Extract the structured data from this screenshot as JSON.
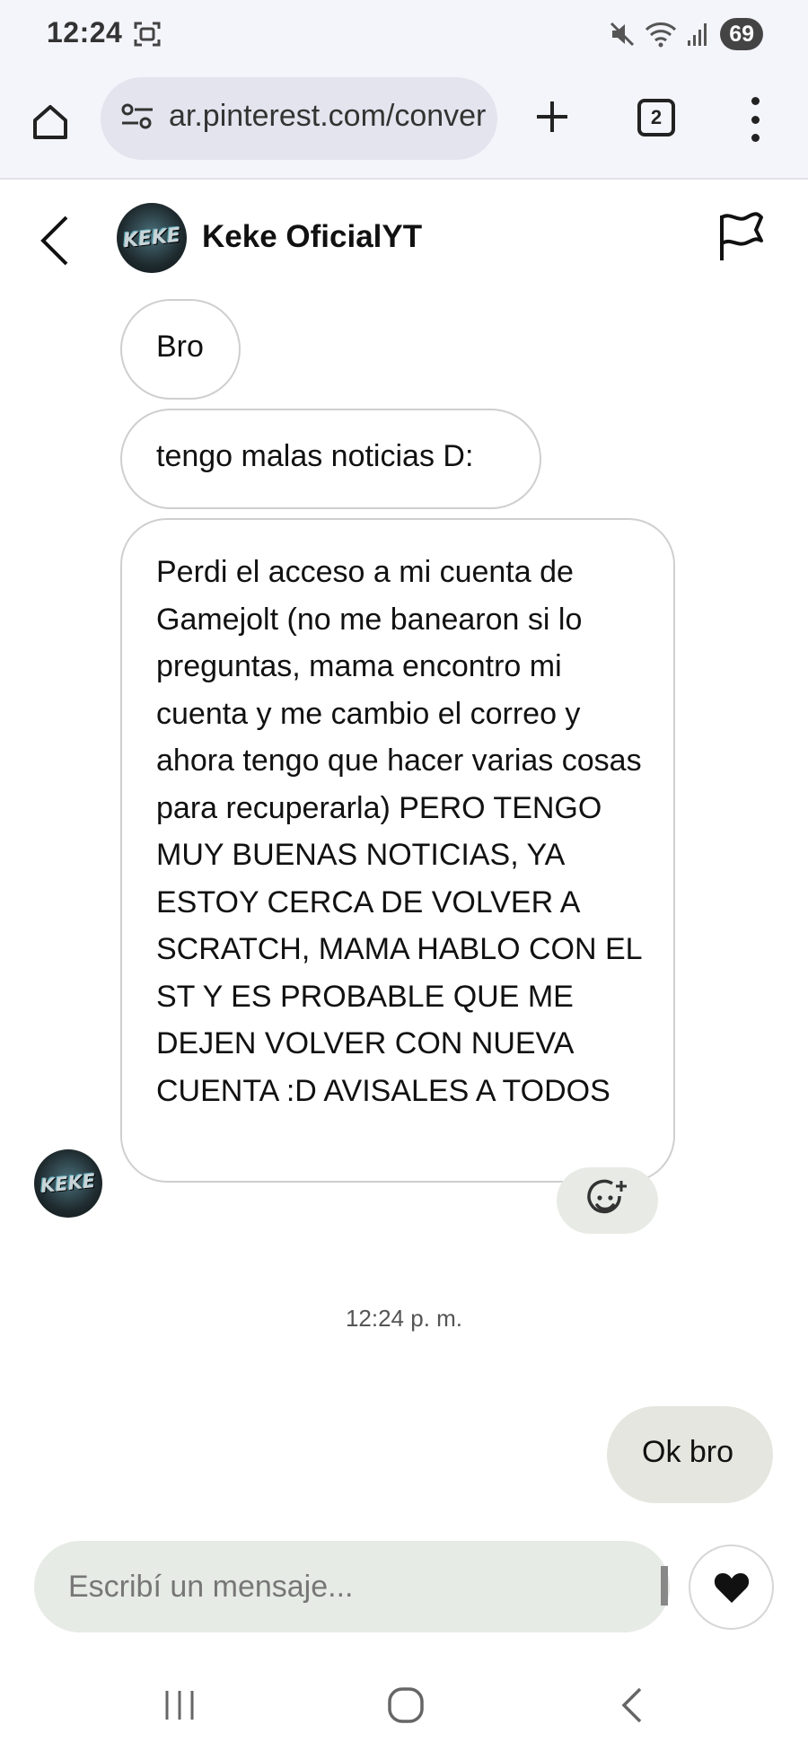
{
  "status_bar": {
    "time": "12:24",
    "battery": "69"
  },
  "browser": {
    "url": "ar.pinterest.com/conversation",
    "tab_count": "2"
  },
  "chat": {
    "contact_name": "Keke OficialYT",
    "avatar_text": "KEKE",
    "messages_in": [
      "Bro",
      "tengo malas noticias D:",
      "Perdi el acceso a mi cuenta de Gamejolt (no me banearon si lo preguntas, mama encontro mi cuenta y me cambio el correo y ahora tengo que hacer varias cosas para recuperarla) PERO TENGO MUY BUENAS NOTICIAS, YA ESTOY CERCA DE VOLVER A SCRATCH, MAMA HABLO CON EL ST Y ES PROBABLE QUE ME DEJEN VOLVER CON NUEVA CUENTA :D AVISALES A TODOS"
    ],
    "timestamp": "12:24 p. m.",
    "message_out": "Ok bro"
  },
  "composer": {
    "placeholder": "Escribí un mensaje..."
  },
  "icons": {
    "home": "home-icon",
    "site_settings": "site-settings-icon",
    "new_tab": "plus-icon",
    "tabs": "tab-switcher-icon",
    "menu": "more-vert-icon",
    "back": "chevron-left-icon",
    "report": "flag-icon",
    "reaction": "add-reaction-icon",
    "like": "heart-icon",
    "recents": "recent-apps-icon",
    "nav_home": "nav-home-icon",
    "nav_back": "nav-back-icon"
  }
}
